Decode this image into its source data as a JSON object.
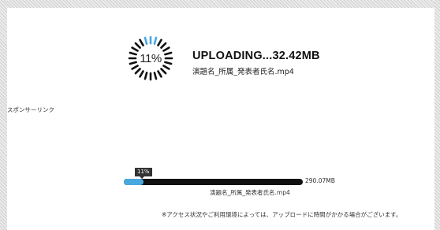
{
  "upload": {
    "percent_label": "11%",
    "progress": 0.11,
    "title": "UPLOADING...32.42MB",
    "file_name": "演題名_所属_発表者氏名.mp4"
  },
  "sidebar": {
    "sponsor_link": "スポンサーリンク"
  },
  "progress_bar": {
    "tooltip": "11%",
    "total_size": "290.07MB",
    "file_name": "演題名_所属_発表者氏名.mp4"
  },
  "notice": "※アクセス状況やご利用環境によっては、アップロードに時間がかかる場合がございます。",
  "colors": {
    "accent": "#49a8e0",
    "track": "#111111",
    "spinner_inactive": "#111111"
  },
  "spinner": {
    "segments": 24,
    "active_segments": 3
  }
}
